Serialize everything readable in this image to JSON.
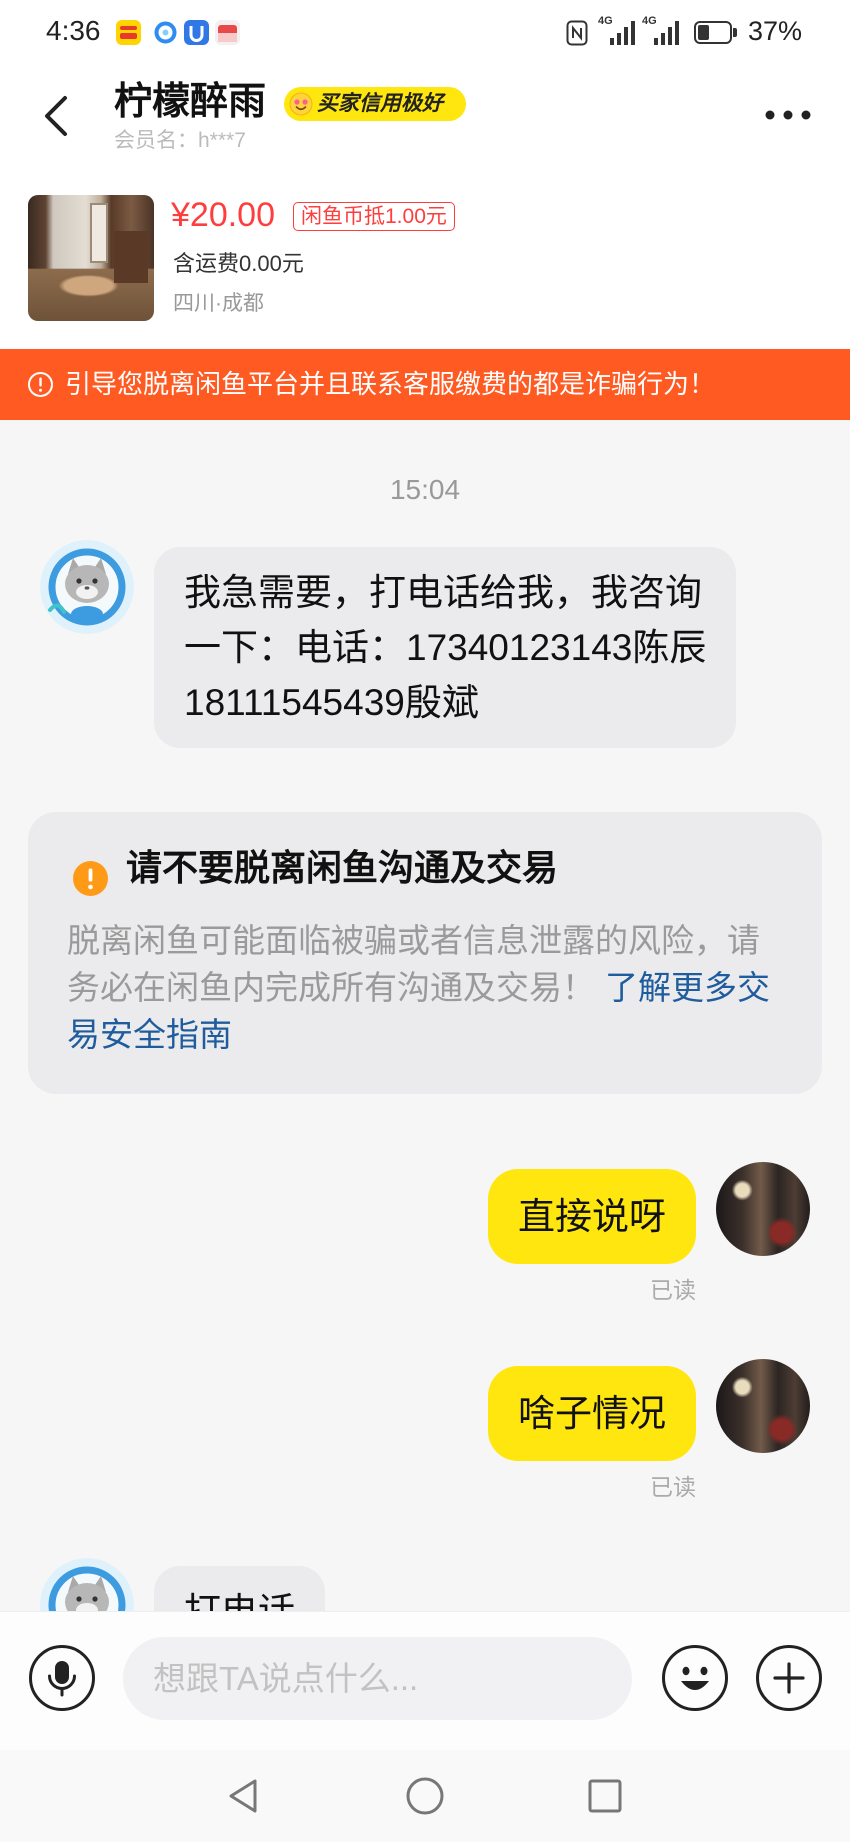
{
  "status_bar": {
    "time": "4:36",
    "network_type": "4G",
    "battery_text": "37%",
    "app_icons": [
      "yellow-app-icon",
      "blue-circle-app-icon",
      "blue-app-icon",
      "red-app-icon"
    ]
  },
  "header": {
    "title": "柠檬醉雨",
    "credit_badge": "买家信用极好",
    "member_name": "会员名：h***7"
  },
  "product": {
    "price": "¥20.00",
    "coin_discount": "闲鱼币抵1.00元",
    "shipping": "含运费0.00元",
    "location": "四川·成都"
  },
  "warning_banner": {
    "text": "引导您脱离闲鱼平台并且联系客服缴费的都是诈骗行为！"
  },
  "chat": {
    "timestamp": "15:04",
    "incoming_first": {
      "lines": [
        "我急需要，打电话给我，我咨询",
        "一下：电话：17340123143陈辰",
        "18111545439殷斌"
      ]
    },
    "safety_notice": {
      "title": "请不要脱离闲鱼沟通及交易",
      "body": "脱离闲鱼可能面临被骗或者信息泄露的风险，请务必在闲鱼内完成所有沟通及交易！",
      "link": "了解更多交易安全指南"
    },
    "outgoing": [
      {
        "text": "直接说呀",
        "read_status": "已读"
      },
      {
        "text": "啥子情况",
        "read_status": "已读"
      }
    ],
    "incoming_last": {
      "text": "打电话"
    }
  },
  "composer": {
    "placeholder": "想跟TA说点什么..."
  },
  "icons": {
    "back": "back-arrow-icon",
    "menu": "more-dots-icon",
    "banner": "alert-circle-icon",
    "notice": "exclamation-icon",
    "voice": "microphone-icon",
    "emoji": "smiley-icon",
    "more": "plus-icon",
    "nav_back": "nav-back-icon",
    "nav_home": "nav-home-icon",
    "nav_recent": "nav-recent-icon"
  },
  "colors": {
    "yellow": "#ffe60f",
    "banner": "#ff5a22",
    "price": "#ff3d3d",
    "link": "#1f5c9e",
    "notice": "#ff9a16"
  }
}
